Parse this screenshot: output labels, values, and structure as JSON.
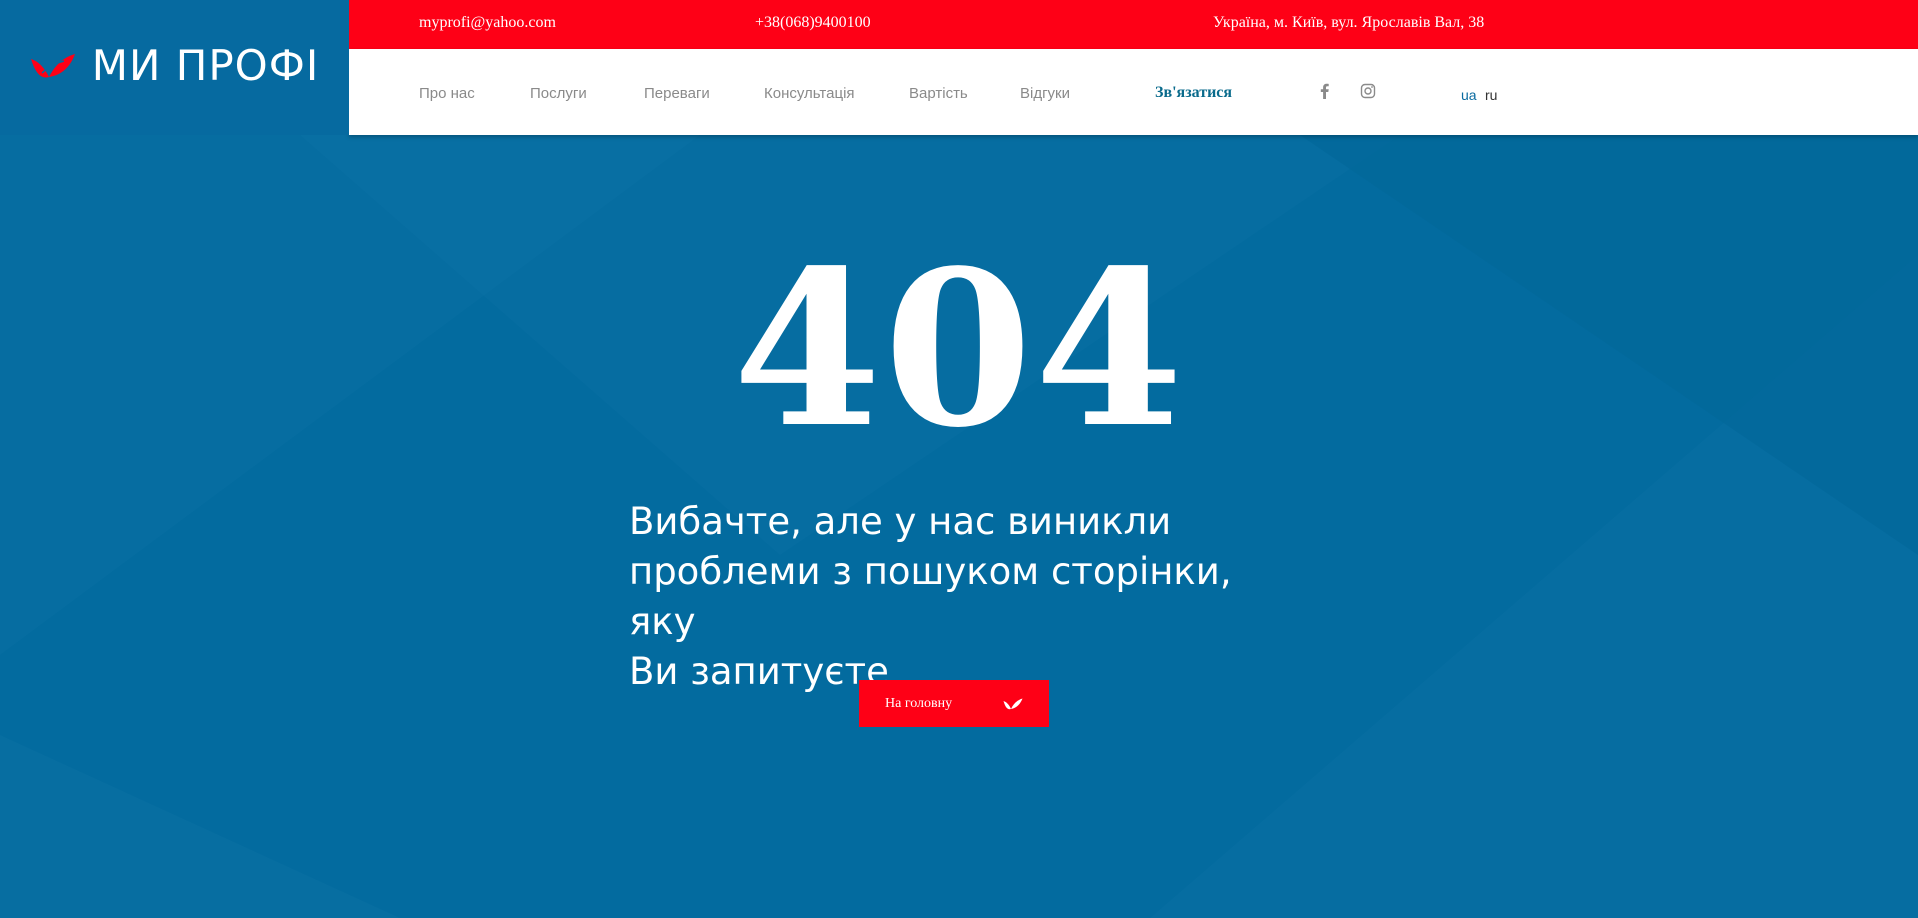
{
  "brand": {
    "name": "МИ ПРОФІ",
    "logo_icon": "brand-wing-icon",
    "color": "#fe0016"
  },
  "topbar": {
    "email": "myprofi@yahoo.com",
    "phone": "+38(068)9400100",
    "address": "Україна, м. Київ, вул. Ярославів Вал, 38"
  },
  "nav": {
    "items": [
      {
        "label": "Про нас"
      },
      {
        "label": "Послуги"
      },
      {
        "label": "Переваги"
      },
      {
        "label": "Консультація"
      },
      {
        "label": "Вартість"
      },
      {
        "label": "Відгуки"
      }
    ],
    "contact_label": "Зв'язатися",
    "social": [
      "facebook-icon",
      "instagram-icon"
    ],
    "languages": {
      "ua": "ua",
      "ru": "ru",
      "active": "ua"
    }
  },
  "error": {
    "code": "404",
    "message_line1": "Вибачте, але у нас виникли",
    "message_line2": "проблеми з пошуком сторінки, яку",
    "message_line3": "Ви запитуєте",
    "button_label": "На головну",
    "button_icon": "brand-wing-icon"
  },
  "colors": {
    "hero_bg": "#036b9f",
    "accent_red": "#fe0016",
    "contact_link": "#0a6b8c"
  }
}
